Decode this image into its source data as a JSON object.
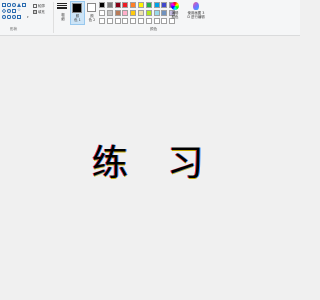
{
  "ribbon": {
    "groups": {
      "shapes_label": "形状",
      "colors_label": "颜色"
    },
    "shapes": {
      "outline_label": "轮廓",
      "fill_label": "填充"
    },
    "lines": {
      "label_line1": "粗",
      "label_line2": "细"
    },
    "color1": {
      "label_line1": "颜",
      "label_line2": "色 1",
      "value": "#000000"
    },
    "color2": {
      "label_line1": "颜",
      "label_line2": "色 2",
      "value": "#ffffff"
    },
    "palette": [
      "#000000",
      "#7f7f7f",
      "#880015",
      "#ed1c24",
      "#ff7f27",
      "#fff200",
      "#22b14c",
      "#00a2e8",
      "#3f48cc",
      "#a349a4",
      "#ffffff",
      "#c3c3c3",
      "#b97a57",
      "#ffaec9",
      "#ffc90e",
      "#efe4b0",
      "#b5e61d",
      "#99d9ea",
      "#7092be",
      "#c8bfe7",
      "#ffffff",
      "#ffffff",
      "#ffffff",
      "#ffffff",
      "#ffffff",
      "#ffffff",
      "#ffffff",
      "#ffffff",
      "#ffffff",
      "#ffffff"
    ],
    "edit_colors": {
      "label_line1": "编辑",
      "label_line2": "颜色"
    },
    "paint3d": {
      "label_line1": "使用画图 3",
      "label_line2": "D 进行编辑"
    }
  },
  "canvas": {
    "text": "练 习"
  }
}
